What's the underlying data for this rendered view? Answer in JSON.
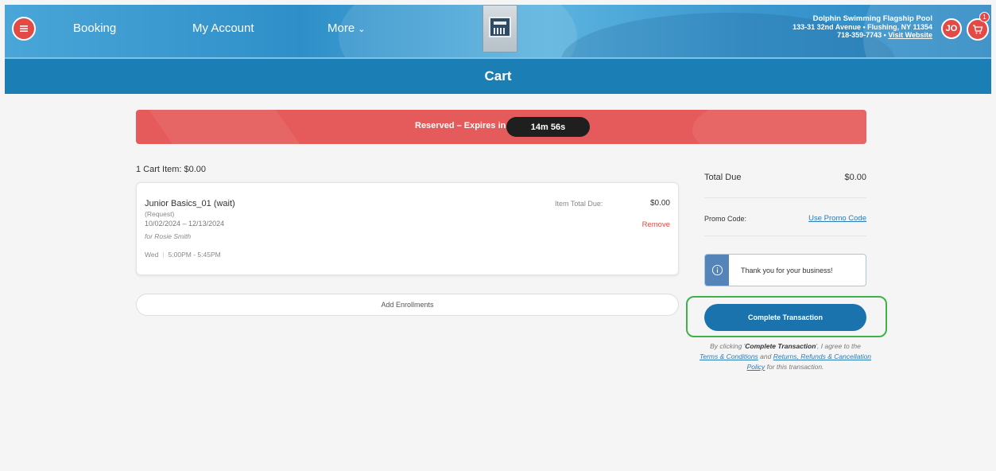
{
  "header": {
    "nav": {
      "booking": "Booking",
      "my_account": "My Account",
      "more": "More"
    },
    "facility": {
      "name": "Dolphin Swimming Flagship Pool",
      "address": "133-31 32nd Avenue • Flushing, NY 11354",
      "phone": "718-359-7743 •",
      "website": "Visit Website"
    },
    "user_initials": "JO",
    "cart_count": "1",
    "page_title": "Cart"
  },
  "reservation": {
    "label": "Reserved – Expires in",
    "timer": "14m 56s"
  },
  "cart": {
    "summary": "1 Cart Item: $0.00",
    "items": [
      {
        "name": "Junior Basics_01 (wait)",
        "status": "(Request)",
        "dates": "10/02/2024 – 12/13/2024",
        "for": "for Rosie Smith",
        "day": "Wed",
        "time": "5:00PM - 5:45PM",
        "total_label": "Item Total Due:",
        "total": "$0.00",
        "remove": "Remove"
      }
    ],
    "add_enrollments": "Add Enrollments"
  },
  "checkout": {
    "total_label": "Total Due",
    "total_value": "$0.00",
    "promo_label": "Promo Code:",
    "promo_link": "Use Promo Code",
    "notice": "Thank you for your business!",
    "complete_button": "Complete Transaction",
    "terms": {
      "prefix": "By clicking '",
      "bold": "Complete Transaction",
      "mid": "', I agree to the",
      "link1": "Terms & Conditions",
      "and": " and ",
      "link2": "Returns, Refunds & Cancellation Policy",
      "suffix": " for this transaction."
    }
  },
  "colors": {
    "brand_blue": "#1b7fb5",
    "accent_red": "#e24a46",
    "highlight_green": "#3fb24a"
  }
}
